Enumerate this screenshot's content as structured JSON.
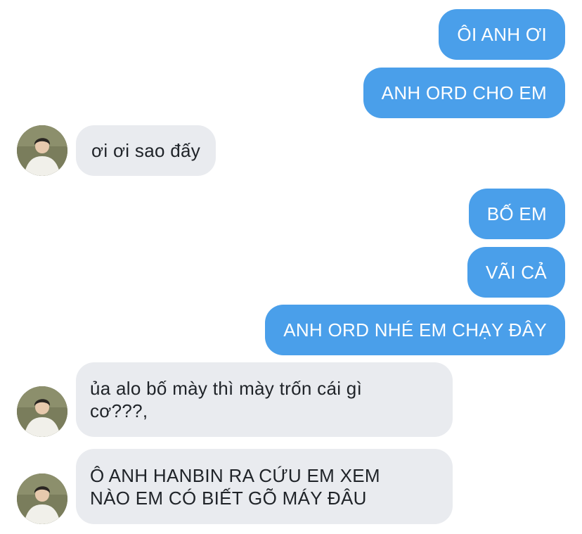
{
  "messages": [
    {
      "side": "out",
      "text": "ÔI ANH ƠI"
    },
    {
      "side": "out",
      "text": "ANH ORD CHO EM"
    },
    {
      "side": "in",
      "text": "ơi ơi sao đấy"
    },
    {
      "side": "out",
      "text": "BỐ EM"
    },
    {
      "side": "out",
      "text": "VÃI CẢ"
    },
    {
      "side": "out",
      "text": "ANH ORD NHÉ EM CHẠY ĐÂY"
    },
    {
      "side": "in",
      "line1": "ủa alo bố mày thì mày trốn cái gì",
      "line2": "cơ???,"
    },
    {
      "side": "in",
      "line1": "Ô ANH HANBIN RA CỨU EM XEM",
      "line2": "NÀO EM CÓ BIẾT GÕ MÁY ĐÂU"
    }
  ],
  "colors": {
    "outgoing_bubble": "#4a9fea",
    "incoming_bubble": "#e9ebef",
    "outgoing_text": "#ffffff",
    "incoming_text": "#1f2328"
  },
  "icons": {
    "avatar": "contact-avatar-photo"
  }
}
